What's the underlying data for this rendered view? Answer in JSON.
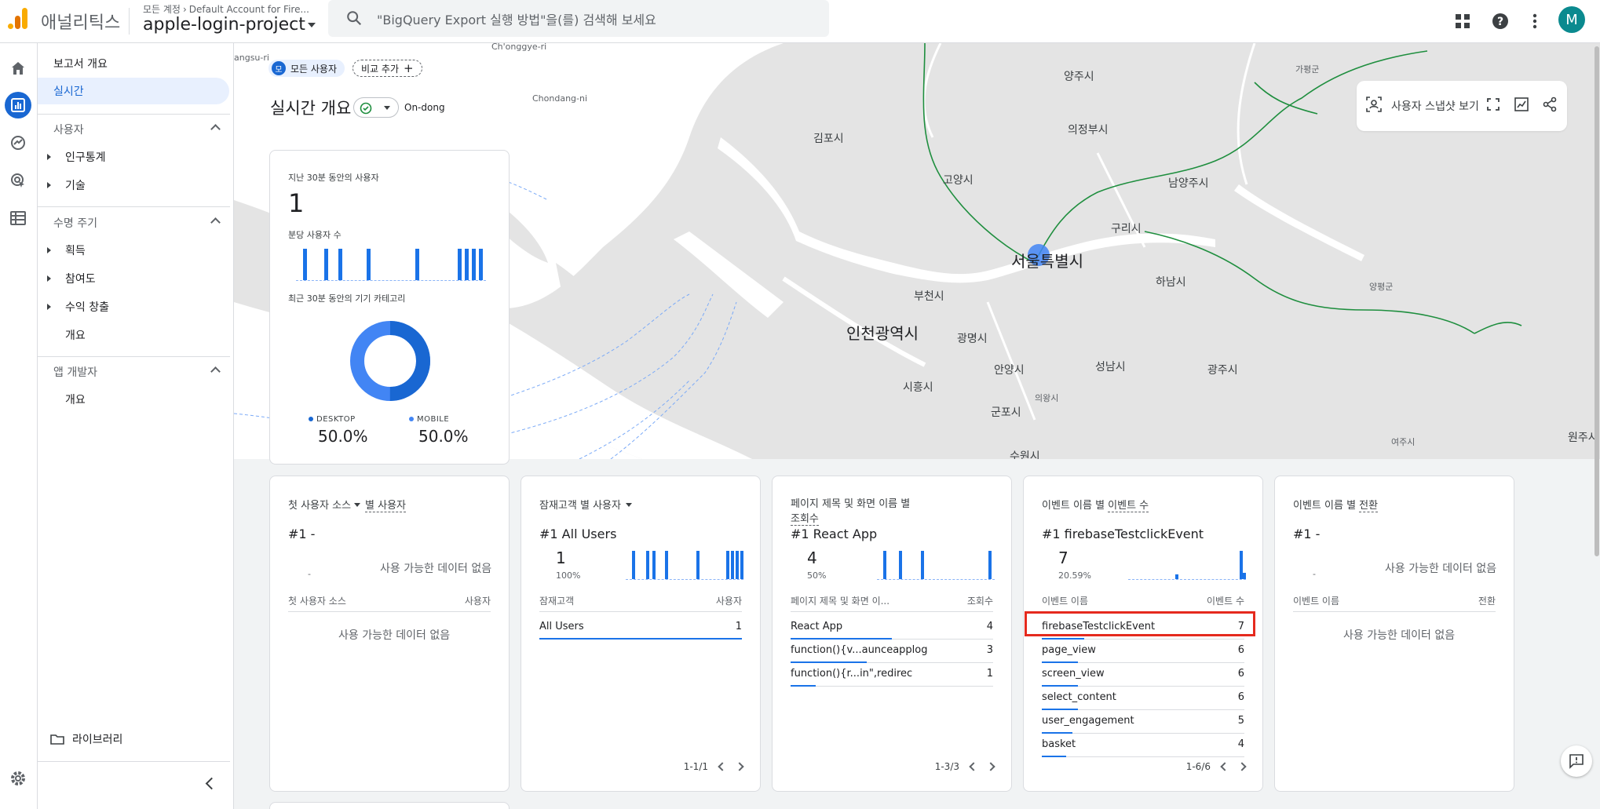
{
  "header": {
    "product": "애널리틱스",
    "breadcrumb_account": "모든 계정",
    "breadcrumb_sub": "Default Account for Fire...",
    "property": "apple-login-project",
    "search_placeholder": "\"BigQuery Export 실행 방법\"을(를) 검색해 보세요",
    "avatar_letter": "M",
    "icons": [
      "apps-grid-icon",
      "help-icon",
      "more-vert-icon"
    ]
  },
  "rail": {
    "icons": [
      "home-icon",
      "reports-icon",
      "explore-icon",
      "advertising-icon",
      "configure-icon",
      "settings-icon"
    ]
  },
  "nav": {
    "overview": "보고서 개요",
    "realtime": "실시간",
    "section_user": "사용자",
    "demographics": "인구통계",
    "tech": "기술",
    "section_lifecycle": "수명 주기",
    "acquisition": "획득",
    "engagement": "참여도",
    "monetization": "수익 창출",
    "lc_overview": "개요",
    "section_dev": "앱 개발자",
    "dev_overview": "개요",
    "library": "라이브러리"
  },
  "map": {
    "chip_all_users": "모든 사용자",
    "chip_avatar": "모",
    "chip_compare": "비교 추가",
    "title": "실시간 개요",
    "location": "On-dong",
    "snapshot_label": "사용자 스냅샷 보기",
    "cities": {
      "seoul": "서울특별시",
      "incheon": "인천광역시",
      "gimpo": "김포시",
      "goyang": "고양시",
      "yangju": "양주시",
      "uijeongbu": "의정부시",
      "namyangju": "남양주시",
      "guri": "구리시",
      "hanam": "하남시",
      "bucheon": "부천시",
      "gwangmyeong": "광명시",
      "anyang": "안양시",
      "siheung": "시흥시",
      "gunpo": "군포시",
      "uiwang": "의왕시",
      "seongnam": "성남시",
      "gwangju": "광주시",
      "gapyeong": "가평군",
      "yangpyeong": "양평군",
      "yeoju": "여주시",
      "wonju": "원주시",
      "suwon": "수원시",
      "chongyeri": "Ch'onggye-ri",
      "chondangni": "Chondang-ni",
      "gangsuri": "angsu-ri"
    }
  },
  "summary": {
    "users_label": "지난 30분 동안의 사용자",
    "users_value": "1",
    "per_minute_label": "분당 사용자 수",
    "per_minute_series": [
      0,
      1,
      0,
      0,
      1,
      0,
      1,
      0,
      0,
      0,
      1,
      0,
      0,
      0,
      0,
      0,
      0,
      1,
      0,
      0,
      0,
      0,
      0,
      1,
      1,
      1,
      1
    ],
    "device_label": "최근 30분 동안의 기기 카테고리",
    "desktop_label": "DESKTOP",
    "desktop_value": "50.0%",
    "mobile_label": "MOBILE",
    "mobile_value": "50.0%",
    "desktop_color": "#1967d2",
    "mobile_color": "#4285f4"
  },
  "cards": {
    "first_source": {
      "title_a": "첫 사용자 소스",
      "title_b": "별 사용자",
      "rank": "#1  -",
      "dash": "-",
      "nodata_top": "사용 가능한 데이터 없음",
      "col1": "첫 사용자 소스",
      "col2": "사용자",
      "nodata": "사용 가능한 데이터 없음"
    },
    "audience": {
      "title_a": "잠재고객 별 사용자",
      "rank": "#1  All Users",
      "big": "1",
      "pct": "100%",
      "col1": "잠재고객",
      "col2": "사용자",
      "rows": [
        {
          "name": "All Users",
          "value": "1",
          "share": 1.0
        }
      ],
      "pager": "1-1/1"
    },
    "pages": {
      "title_a": "페이지 제목 및 화면 이름 별",
      "title_b": "조회수",
      "rank": "#1  React App",
      "big": "4",
      "pct": "50%",
      "col1": "페이지 제목 및 화면 이...",
      "col2": "조회수",
      "rows": [
        {
          "name": "React App",
          "value": "4",
          "share": 0.5
        },
        {
          "name": "function(){v...aunceapplog",
          "value": "3",
          "share": 0.375
        },
        {
          "name": "function(){r...in\",redirec",
          "value": "1",
          "share": 0.125
        }
      ],
      "pager": "1-3/3"
    },
    "events": {
      "title_a": "이벤트 이름 별",
      "title_b": "이벤트 수",
      "rank": "#1  firebaseTestclickEvent",
      "big": "7",
      "pct": "20.59%",
      "col1": "이벤트 이름",
      "col2": "이벤트 수",
      "rows": [
        {
          "name": "firebaseTestclickEvent",
          "value": "7",
          "share": 0.21
        },
        {
          "name": "page_view",
          "value": "6",
          "share": 0.18
        },
        {
          "name": "screen_view",
          "value": "6",
          "share": 0.18
        },
        {
          "name": "select_content",
          "value": "6",
          "share": 0.18
        },
        {
          "name": "user_engagement",
          "value": "5",
          "share": 0.15
        },
        {
          "name": "basket",
          "value": "4",
          "share": 0.12
        }
      ],
      "pager": "1-6/6"
    },
    "conversions": {
      "title_a": "이벤트 이름 별",
      "title_b": "전환",
      "rank": "#1  -",
      "dash": "-",
      "nodata_top": "사용 가능한 데이터 없음",
      "col1": "이벤트 이름",
      "col2": "전환",
      "nodata": "사용 가능한 데이터 없음"
    }
  },
  "colors": {
    "accent": "#1967d2",
    "highlight": "#e52a1e"
  }
}
